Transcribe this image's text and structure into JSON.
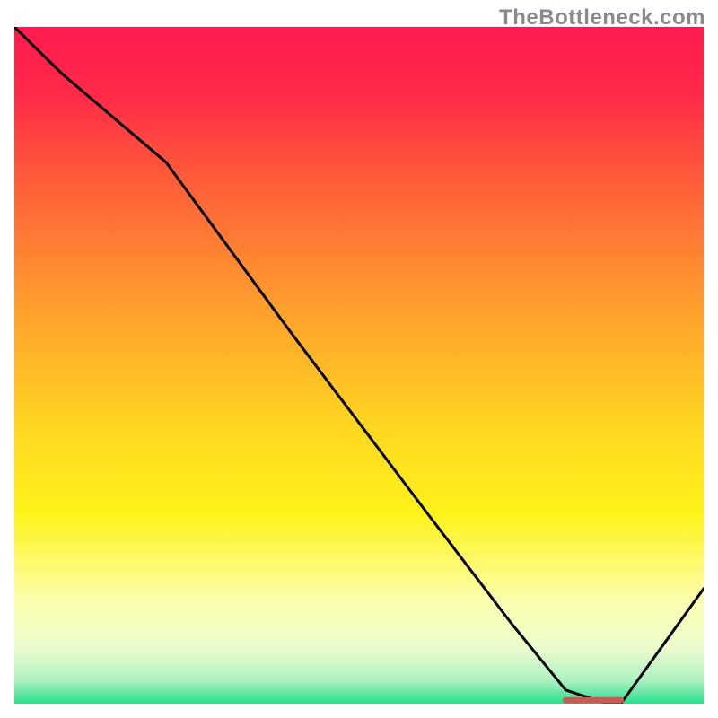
{
  "watermark": "TheBottleneck.com",
  "chart_data": {
    "type": "line",
    "title": "",
    "xlabel": "",
    "ylabel": "",
    "xlim": [
      0,
      100
    ],
    "ylim": [
      0,
      100
    ],
    "grid": false,
    "legend": false,
    "series": [
      {
        "name": "bottleneck-curve",
        "x": [
          0,
          7,
          22,
          40,
          60,
          72,
          80,
          86,
          88,
          100
        ],
        "y": [
          100,
          93,
          80,
          55,
          28,
          12,
          2,
          0,
          0,
          17
        ]
      }
    ],
    "marker": {
      "name": "optimal-marker",
      "x_start": 80,
      "x_end": 88,
      "y": 0.5,
      "color": "#c85a55"
    },
    "background_gradient": {
      "stops": [
        {
          "pos": 0.0,
          "color": "#ff1a4f"
        },
        {
          "pos": 0.1,
          "color": "#ff2a48"
        },
        {
          "pos": 0.22,
          "color": "#ff5a3a"
        },
        {
          "pos": 0.4,
          "color": "#ff9a2e"
        },
        {
          "pos": 0.58,
          "color": "#ffd321"
        },
        {
          "pos": 0.72,
          "color": "#fff31a"
        },
        {
          "pos": 0.85,
          "color": "#fcffb0"
        },
        {
          "pos": 0.92,
          "color": "#eafccf"
        },
        {
          "pos": 0.965,
          "color": "#aef2c0"
        },
        {
          "pos": 1.0,
          "color": "#2adf8f"
        }
      ]
    }
  }
}
